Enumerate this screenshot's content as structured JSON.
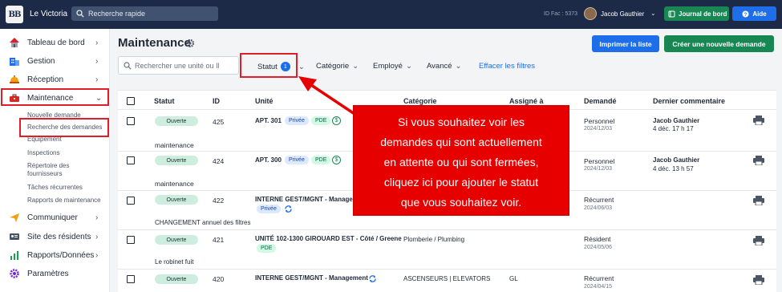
{
  "topbar": {
    "logo_text": "BB",
    "app_name": "Le Victoria",
    "search_placeholder": "Recherche rapide",
    "id_fac": "ID Fac : 5373",
    "user_name": "Jacob Gauthier",
    "journal_label": "Journal de bord",
    "aide_label": "Aide"
  },
  "sidebar": {
    "items": [
      {
        "label": "Tableau de bord",
        "icon": "home-icon"
      },
      {
        "label": "Gestion",
        "icon": "building-icon"
      },
      {
        "label": "Réception",
        "icon": "bell-icon"
      },
      {
        "label": "Maintenance",
        "icon": "toolbox-icon"
      },
      {
        "label": "Communiquer",
        "icon": "send-icon"
      },
      {
        "label": "Site des résidents",
        "icon": "id-card-icon"
      },
      {
        "label": "Rapports/Données",
        "icon": "chart-icon"
      },
      {
        "label": "Paramètres",
        "icon": "gear-icon"
      }
    ],
    "sub_items": [
      "Nouvelle demande",
      "Recherche des demandes",
      "Équipement",
      "Inspections",
      "Répertoire des",
      "fournisseurs",
      "Tâches récurrentes",
      "Rapports de maintenance"
    ]
  },
  "page": {
    "title": "Maintenance",
    "print_label": "Imprimer la liste",
    "create_label": "Créer une nouvelle demande"
  },
  "filters": {
    "search_placeholder": "Rechercher une unité ou Il",
    "statut": "Statut",
    "statut_count": "1",
    "categorie": "Catégorie",
    "employe": "Employé",
    "avance": "Avancé",
    "clear": "Effacer les filtres"
  },
  "table": {
    "headers": [
      "Statut",
      "ID",
      "Unité",
      "Catégorie",
      "Assigné à",
      "Demandé",
      "Dernier commentaire"
    ],
    "rows": [
      {
        "status": "Ouverte",
        "id": "425",
        "unit": "APT. 301",
        "tags": [
          "Privée",
          "PDE"
        ],
        "dollar": "$",
        "description": "maintenance",
        "requested": "Personnel",
        "date": "2024/12/03",
        "comment_author": "Jacob Gauthier",
        "comment_time": "4 déc. 17 h 17"
      },
      {
        "status": "Ouverte",
        "id": "424",
        "unit": "APT. 300",
        "tags": [
          "Privée",
          "PDE"
        ],
        "dollar": "$",
        "description": "maintenance",
        "requested": "Personnel",
        "date": "2024/12/03",
        "comment_author": "Jacob Gauthier",
        "comment_time": "4 déc. 13 h 57"
      },
      {
        "status": "Ouverte",
        "id": "422",
        "unit": "INTERNE GEST/MGNT - Managem",
        "tags": [
          "Privée"
        ],
        "description": "CHANGEMENT annuel des filtres",
        "requested": "Récurrent",
        "date": "2024/06/03"
      },
      {
        "status": "Ouverte",
        "id": "421",
        "unit": "UNITÉ 102-1300 GIROUARD EST - Côté / Greene",
        "tags": [
          "PDE"
        ],
        "category": "Plomberie / Plumbing",
        "description": "Le robinet fuit",
        "requested": "Résident",
        "date": "2024/05/06"
      },
      {
        "status": "Ouverte",
        "id": "420",
        "unit": "INTERNE GEST/MGNT - Management",
        "category": "ASCENSEURS | ELEVATORS",
        "assigned": "GL",
        "requested": "Récurrent",
        "date": "2024/04/15"
      }
    ]
  },
  "callout": {
    "lines": [
      "Si vous souhaitez voir les",
      "demandes qui sont actuellement",
      "en attente ou qui sont fermées,",
      "cliquez ici pour ajouter le statut",
      "que vous souhaitez voir."
    ]
  },
  "colors": {
    "topbar": "#1c2a48",
    "primary_blue": "#1d6ee8",
    "green": "#198754",
    "annotation_red": "#e60000"
  }
}
